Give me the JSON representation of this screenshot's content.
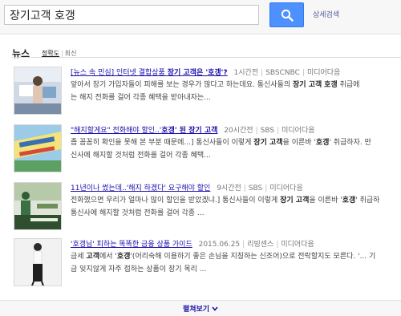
{
  "search": {
    "query": "장기고객 호갱",
    "advanced_link": "상세검색"
  },
  "category": {
    "title": "뉴스",
    "sort_accuracy": "정확도",
    "sort_latest": "최신"
  },
  "results": [
    {
      "headline_pre": "[뉴스 속 민심] 인터넷 결합상품 ",
      "headline_bold": "장기 고객은 '호갱'?",
      "time": "1시간전",
      "source": "SBSCNBC",
      "via": "미디어다음",
      "line1_pre": "앞아서 장기 가입자들이 피해를 보는 경우가 많다고 하는데요. 통신사들의 ",
      "line1_bold1": "장기 고객",
      "line1_mid": " ",
      "line1_bold2": "호갱",
      "line1_post": " 취급에",
      "line2": "는 해지 전화를 걸어 각종 혜택을 받아내자는..."
    },
    {
      "headline_pre": "\"해지할게요\" 전화해야 할인..'",
      "headline_bold": "호갱' 된 장기 고객",
      "time": "20시간전",
      "source": "SBS",
      "via": "미디어다음",
      "line1_pre": "좀 꼼꼼히 확인을 못해 본 부분 때문에...] 통신사들이 이렇게 ",
      "line1_bold1": "장기 고객",
      "line1_mid": "을 이른바 '",
      "line1_bold2": "호갱",
      "line1_post": "' 취급하자. 만",
      "line2": "신사에 해지할 것처럼 전화를 걸어 각종 혜택..."
    },
    {
      "headline_pre": "11년이나 썼는데..'해지 하겠다' 요구해야 할인",
      "headline_bold": "",
      "time": "9시간전",
      "source": "SBS",
      "via": "미디어다음",
      "line1_pre": "전화했으면 우리가 얼마나 많이 할인을 받았겠냐.] 통신사들이 이렇게 ",
      "line1_bold1": "장기 고객",
      "line1_mid": "을 이른바 '",
      "line1_bold2": "호갱",
      "line1_post": "' 취급하",
      "line2": "통신사에 해지할 것처럼 전화를 걸어 각종 ..."
    },
    {
      "headline_pre": "'호갱님' 피하는 똑똑한 금융 상품 가이드",
      "headline_bold": "",
      "time": "2015.06.25",
      "source": "리빙센스",
      "via": "미디어다음",
      "line1_pre": "금세 ",
      "line1_bold1": "고객",
      "line1_mid": "에서 '",
      "line1_bold2": "호갱",
      "line1_post": "'(어리숙해 이용하기 좋은 손님을 지칭하는 신조어)으로 전락할지도 모른다. '... 기",
      "line2": "금 잊지않게 자주 접하는 상품이 장기 목리 ..."
    }
  ],
  "more": {
    "label": "펼쳐보기"
  }
}
